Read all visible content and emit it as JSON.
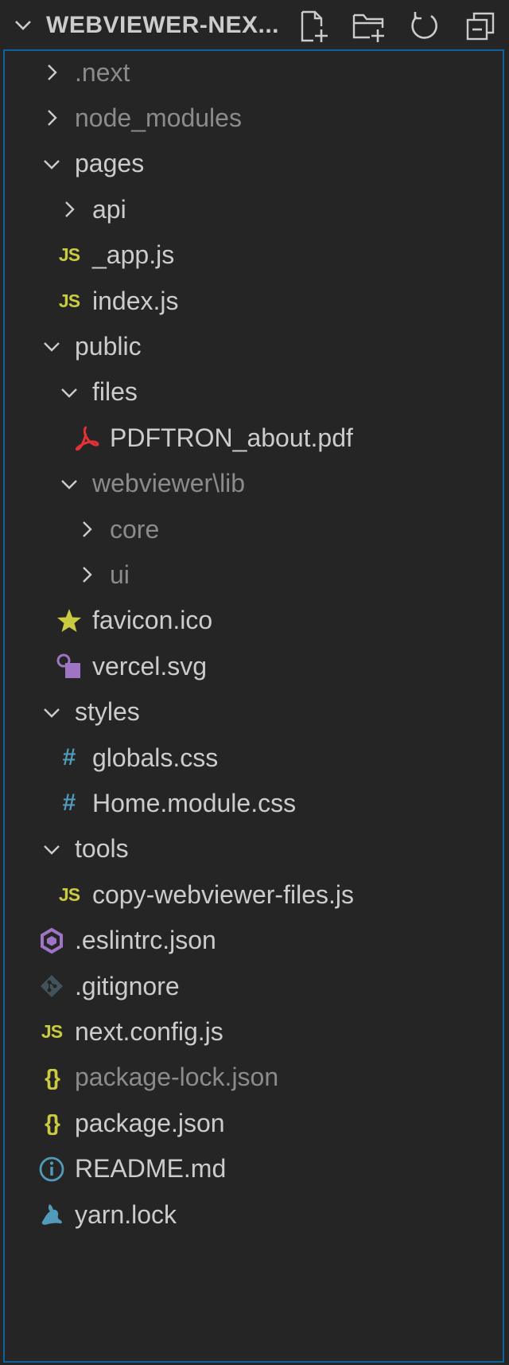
{
  "explorer": {
    "title": "WEBVIEWER-NEX...",
    "actions": [
      {
        "name": "new-file-button",
        "icon": "new-file-icon"
      },
      {
        "name": "new-folder-button",
        "icon": "new-folder-icon"
      },
      {
        "name": "refresh-button",
        "icon": "refresh-icon"
      },
      {
        "name": "collapse-all-button",
        "icon": "collapse-all-icon"
      }
    ]
  },
  "tree": [
    {
      "label": ".next",
      "type": "folder",
      "expanded": false,
      "depth": 1,
      "dim": true
    },
    {
      "label": "node_modules",
      "type": "folder",
      "expanded": false,
      "depth": 1,
      "dim": true
    },
    {
      "label": "pages",
      "type": "folder",
      "expanded": true,
      "depth": 1
    },
    {
      "label": "api",
      "type": "folder",
      "expanded": false,
      "depth": 2
    },
    {
      "label": "_app.js",
      "type": "js",
      "depth": 2
    },
    {
      "label": "index.js",
      "type": "js",
      "depth": 2
    },
    {
      "label": "public",
      "type": "folder",
      "expanded": true,
      "depth": 1
    },
    {
      "label": "files",
      "type": "folder",
      "expanded": true,
      "depth": 2
    },
    {
      "label": "PDFTRON_about.pdf",
      "type": "pdf",
      "depth": 3
    },
    {
      "label": "webviewer\\lib",
      "type": "folder",
      "expanded": true,
      "depth": 2,
      "dim": true
    },
    {
      "label": "core",
      "type": "folder",
      "expanded": false,
      "depth": 3,
      "dim": true
    },
    {
      "label": "ui",
      "type": "folder",
      "expanded": false,
      "depth": 3,
      "dim": true
    },
    {
      "label": "favicon.ico",
      "type": "favicon",
      "depth": 2
    },
    {
      "label": "vercel.svg",
      "type": "svg",
      "depth": 2
    },
    {
      "label": "styles",
      "type": "folder",
      "expanded": true,
      "depth": 1
    },
    {
      "label": "globals.css",
      "type": "css",
      "depth": 2
    },
    {
      "label": "Home.module.css",
      "type": "css",
      "depth": 2
    },
    {
      "label": "tools",
      "type": "folder",
      "expanded": true,
      "depth": 1
    },
    {
      "label": "copy-webviewer-files.js",
      "type": "js",
      "depth": 2
    },
    {
      "label": ".eslintrc.json",
      "type": "eslint",
      "depth": 1
    },
    {
      "label": ".gitignore",
      "type": "git",
      "depth": 1
    },
    {
      "label": "next.config.js",
      "type": "js",
      "depth": 1
    },
    {
      "label": "package-lock.json",
      "type": "json",
      "depth": 1,
      "dim": true
    },
    {
      "label": "package.json",
      "type": "json",
      "depth": 1
    },
    {
      "label": "README.md",
      "type": "info",
      "depth": 1
    },
    {
      "label": "yarn.lock",
      "type": "yarn",
      "depth": 1
    }
  ],
  "badges": {
    "js": "JS",
    "css": "#",
    "json": "{}"
  },
  "colors": {
    "background": "#252526",
    "focus_border": "#0e639c",
    "text": "#cccccc",
    "dim_text": "#8b8b8b",
    "js": "#cbcb41",
    "css": "#519aba",
    "pdf": "#e23237",
    "svg": "#a074c4",
    "eslint": "#a074c4",
    "git": "#41535b",
    "info": "#519aba",
    "yarn": "#519aba"
  }
}
